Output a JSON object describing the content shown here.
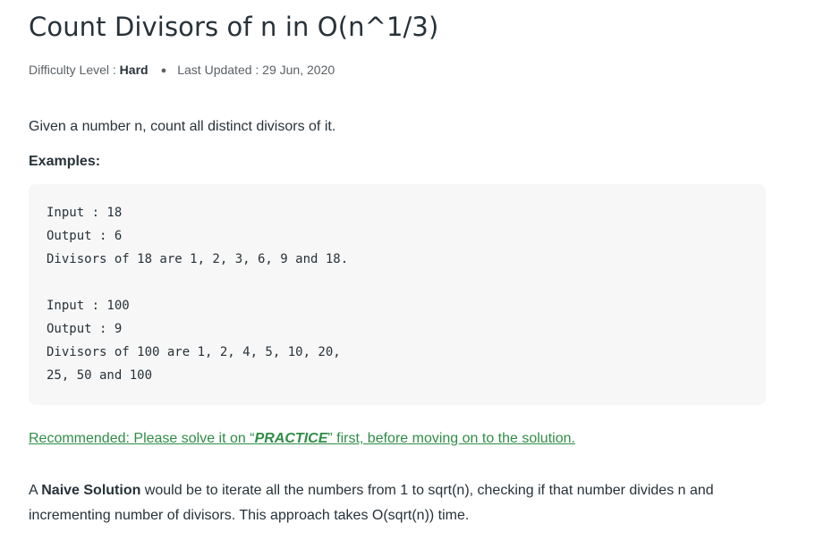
{
  "article": {
    "title": "Count Divisors of n in O(n^1/3)",
    "meta": {
      "difficulty_label": "Difficulty Level : ",
      "difficulty_value": "Hard",
      "separator": "●",
      "updated_label": "Last Updated : 29 Jun, 2020"
    },
    "intro": "Given a number n, count all distinct divisors of it.",
    "examples_heading": "Examples:",
    "code_lines": [
      "Input : 18",
      "Output : 6",
      "Divisors of 18 are 1, 2, 3, 6, 9 and 18.",
      "",
      "Input : 100",
      "Output : 9",
      "Divisors of 100 are 1, 2, 4, 5, 10, 20,",
      "25, 50 and 100"
    ],
    "recommended": {
      "prefix": "Recommended: Please solve it on “",
      "practice": "PRACTICE",
      "suffix": "” first, before moving on to the solution."
    },
    "paragraph": {
      "lead": "A ",
      "bold": "Naive Solution",
      "rest": " would be to iterate all the numbers from 1 to sqrt(n), checking if that number divides n and incrementing number of divisors. This approach takes O(sqrt(n)) time."
    }
  },
  "colors": {
    "text": "#273239",
    "muted": "#5b6166",
    "link_green": "#2f8d46",
    "code_bg": "#f7f7f7"
  }
}
